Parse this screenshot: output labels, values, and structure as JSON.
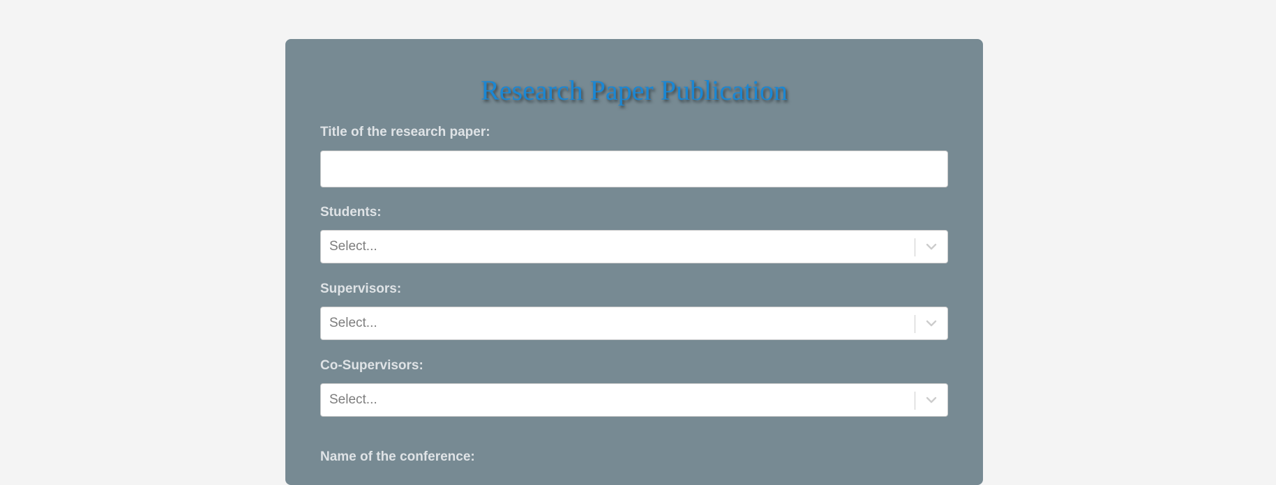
{
  "form": {
    "title": "Research Paper Publication",
    "fields": {
      "paper_title": {
        "label": "Title of the research paper:",
        "value": "",
        "placeholder": ""
      },
      "students": {
        "label": "Students:",
        "placeholder": "Select..."
      },
      "supervisors": {
        "label": "Supervisors:",
        "placeholder": "Select..."
      },
      "co_supervisors": {
        "label": "Co-Supervisors:",
        "placeholder": "Select..."
      },
      "conference": {
        "label": "Name of the conference:"
      }
    }
  },
  "icons": {
    "dropdown": "chevron-down-icon"
  },
  "colors": {
    "page_background": "#f4f4f4",
    "card_background": "#778a93",
    "title": "#1a87d4",
    "label": "#dfe3e6"
  }
}
